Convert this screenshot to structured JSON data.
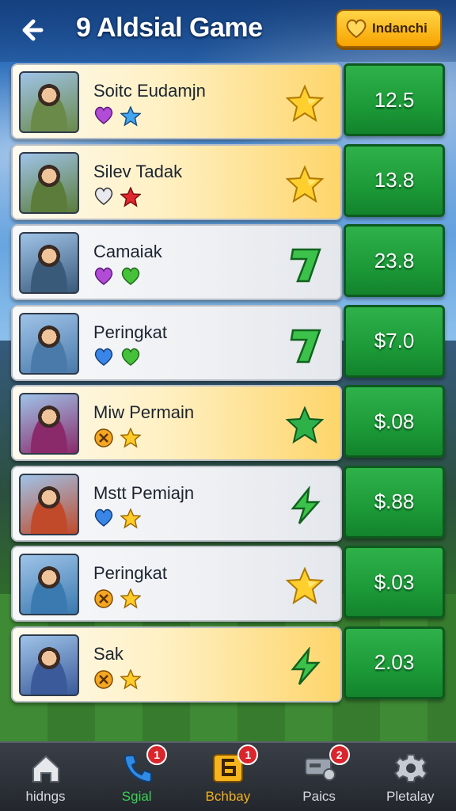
{
  "header": {
    "title": "9 Aldsial Game",
    "action_label": "Indanchi"
  },
  "rows": [
    {
      "name": "Soitc Eudamjn",
      "score": "12.5",
      "style": "gold",
      "gems": [
        "purple-heart",
        "blue-star"
      ],
      "rank": "gold-star",
      "avatar_color": "#6a8a4a"
    },
    {
      "name": "Silev Tadak",
      "score": "13.8",
      "style": "gold",
      "gems": [
        "silver-heart",
        "red-star"
      ],
      "rank": "gold-star",
      "avatar_color": "#5b7c3a"
    },
    {
      "name": "Camaiak",
      "score": "23.8",
      "style": "silver",
      "gems": [
        "purple-heart",
        "green-heart"
      ],
      "rank": "green-seven",
      "avatar_color": "#3a5a7a"
    },
    {
      "name": "Peringkat",
      "score": "$7.0",
      "style": "silver",
      "gems": [
        "blue-heart",
        "green-heart"
      ],
      "rank": "green-seven",
      "avatar_color": "#4a7aaa"
    },
    {
      "name": "Miw Permain",
      "score": "$.08",
      "style": "gold",
      "gems": [
        "orange-coin",
        "gold-star"
      ],
      "rank": "green-star",
      "avatar_color": "#8a2a6a"
    },
    {
      "name": "Mstt Pemiajn",
      "score": "$.88",
      "style": "silver",
      "gems": [
        "blue-heart",
        "gold-star"
      ],
      "rank": "green-bolt",
      "avatar_color": "#c04a2a"
    },
    {
      "name": "Peringkat",
      "score": "$.03",
      "style": "silver",
      "gems": [
        "orange-coin",
        "gold-star"
      ],
      "rank": "gold-star",
      "avatar_color": "#3a7ab0"
    },
    {
      "name": "Sak",
      "score": "2.03",
      "style": "gold",
      "gems": [
        "orange-coin",
        "gold-star"
      ],
      "rank": "green-bolt",
      "avatar_color": "#3a5a9a"
    }
  ],
  "nav": [
    {
      "label": "hidngs",
      "icon": "home-icon",
      "badge": "",
      "color": "#d7dbe0"
    },
    {
      "label": "Sgial",
      "icon": "phone-icon",
      "badge": "1",
      "color": "#39d353"
    },
    {
      "label": "Bchbay",
      "icon": "six-tile-icon",
      "badge": "1",
      "color": "#f3b21a"
    },
    {
      "label": "Paics",
      "icon": "ticket-gear-icon",
      "badge": "2",
      "color": "#d7dbe0"
    },
    {
      "label": "Pletalay",
      "icon": "gear-icon",
      "badge": "",
      "color": "#d7dbe0"
    }
  ],
  "colors": {
    "score_green": "#1c9a38",
    "header_gold": "#f7a400",
    "badge_red": "#d9252c"
  }
}
